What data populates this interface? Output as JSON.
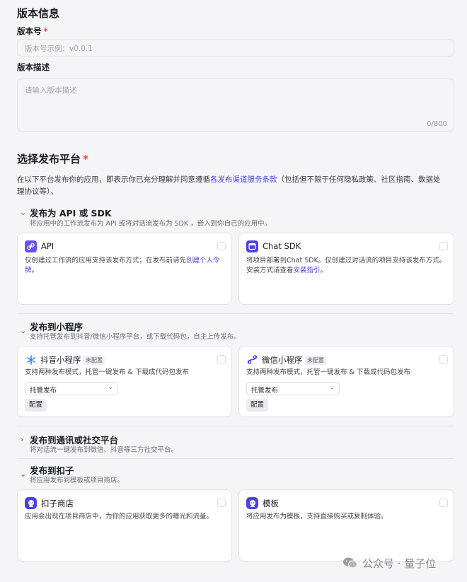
{
  "version_info": {
    "title": "版本信息",
    "version_label": "版本号",
    "required_mark": "*",
    "version_placeholder": "版本号示例：v0.0.1",
    "desc_label": "版本描述",
    "desc_placeholder": "请输入版本描述",
    "desc_counter": "0/800"
  },
  "platform": {
    "title": "选择发布平台",
    "required_mark": "*",
    "intro_before": "在以下平台发布你的应用，即表示你已充分理解并同意遵循",
    "intro_link": "各发布渠道服务条款",
    "intro_after_line1": "（包括但不限于任何隐私政策、社区指南、数据处",
    "intro_line2": "理协议等）。"
  },
  "sections": {
    "api": {
      "chevron": "⌄",
      "title": "发布为 API 或 SDK",
      "desc": "将应用中的工作流发布为 API 或将对话流发布为 SDK ，嵌入到你自己的应用中。",
      "cards": {
        "api": {
          "title": "API",
          "desc_before": "仅创建过工作流的应用支持该发布方式；在发布前请先",
          "desc_link": "创建个人令",
          "desc_line2_link": "牌",
          "desc_line2_after": "。"
        },
        "sdk": {
          "title": "Chat SDK",
          "desc_line1": "将项目部署到Chat SDK。仅创建过对话流的项目支持该发布方式。",
          "desc_line2_before": "安装方式请查看",
          "desc_line2_link": "安装指引",
          "desc_line2_after": "。"
        }
      }
    },
    "mini": {
      "chevron": "⌄",
      "title": "发布到小程序",
      "desc": "支持托管发布到抖音/微信小程序平台，或下载代码包，自主上传发布。",
      "cards": {
        "douyin": {
          "title": "抖音小程序",
          "badge": "未配置",
          "desc": "支持两种发布模式，托管一键发布 & 下载成代码包发布",
          "select": "托管发布",
          "config": "配置"
        },
        "wechat": {
          "title": "微信小程序",
          "badge": "未配置",
          "desc": "支持两种发布模式，托管一键发布 & 下载成代码包发布",
          "select": "托管发布",
          "config": "配置"
        }
      }
    },
    "social": {
      "chevron": "›",
      "title": "发布到通讯或社交平台",
      "desc": "将对话流一键发布到微信、抖音等三方社交平台。"
    },
    "kouzi": {
      "chevron": "⌄",
      "title": "发布到扣子",
      "desc": "将应用发布到模板或项目商店。",
      "cards": {
        "store": {
          "title": "扣子商店",
          "desc": "应用会出现在项目商店中，为你的应用获取更多的曝光和流量。"
        },
        "template": {
          "title": "模板",
          "desc": "将应用发布为模板，支持直接购买或复制体验。"
        }
      }
    }
  },
  "watermark": {
    "text": "公众号 · 量子位",
    "icon": "wechat-icon"
  },
  "colors": {
    "accent": "#4e40e5",
    "required": "#e5483b",
    "background": "#f5f5f7",
    "card": "#ffffff"
  }
}
